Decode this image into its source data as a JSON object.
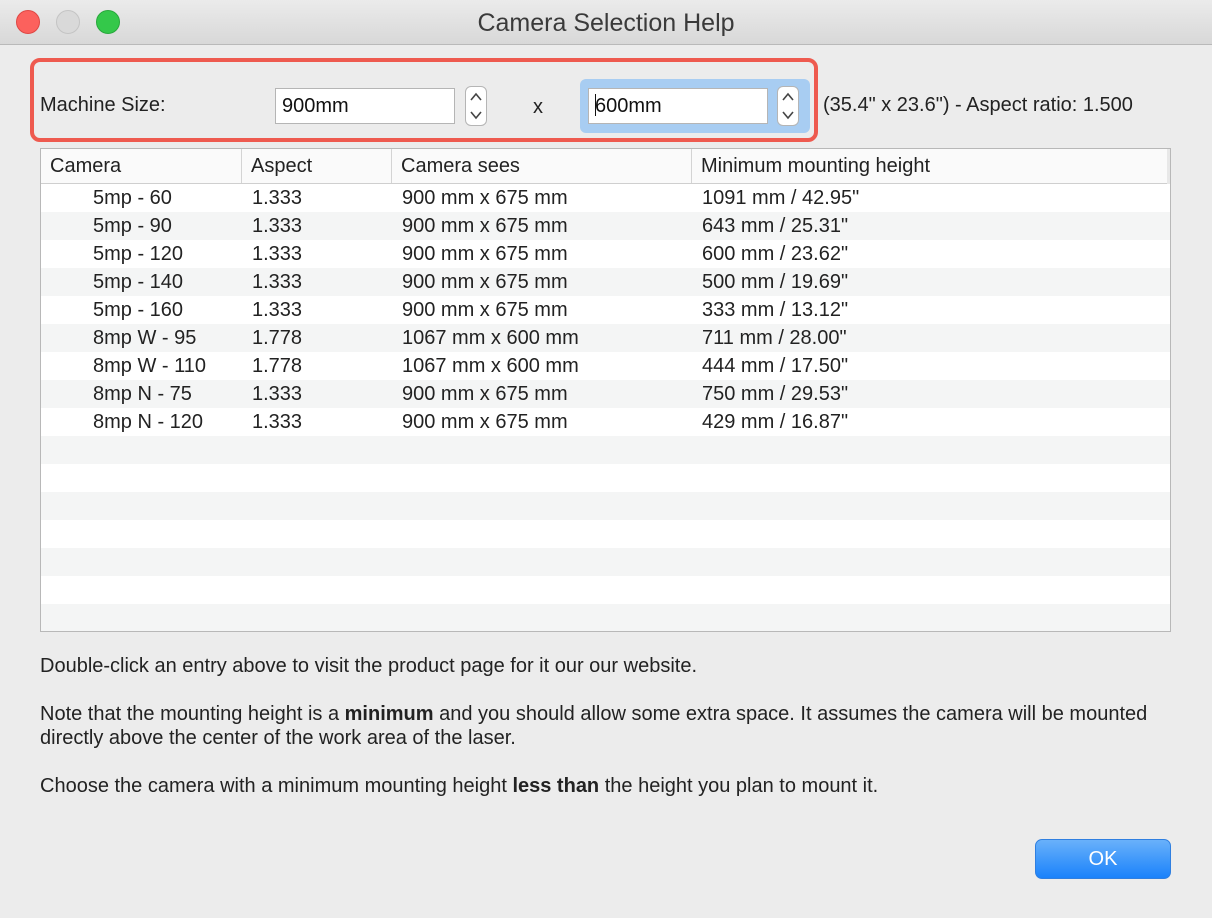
{
  "window": {
    "title": "Camera Selection Help"
  },
  "machine": {
    "label": "Machine Size:",
    "width_value": "900mm",
    "height_value": "600mm",
    "times": "x",
    "summary": "(35.4\" x 23.6\") - Aspect ratio: 1.500"
  },
  "table": {
    "columns": [
      "Camera",
      "Aspect",
      "Camera sees",
      "Minimum mounting height"
    ],
    "rows": [
      [
        "5mp - 60",
        "1.333",
        "900 mm x 675 mm",
        "1091 mm / 42.95\""
      ],
      [
        "5mp - 90",
        "1.333",
        "900 mm x 675 mm",
        "643 mm / 25.31\""
      ],
      [
        "5mp - 120",
        "1.333",
        "900 mm x 675 mm",
        "600 mm / 23.62\""
      ],
      [
        "5mp - 140",
        "1.333",
        "900 mm x 675 mm",
        "500 mm / 19.69\""
      ],
      [
        "5mp - 160",
        "1.333",
        "900 mm x 675 mm",
        "333 mm / 13.12\""
      ],
      [
        "8mp W - 95",
        "1.778",
        "1067 mm x 600 mm",
        "711 mm / 28.00\""
      ],
      [
        "8mp W - 110",
        "1.778",
        "1067 mm x 600 mm",
        "444 mm / 17.50\""
      ],
      [
        "8mp N - 75",
        "1.333",
        "900 mm x 675 mm",
        "750 mm / 29.53\""
      ],
      [
        "8mp N - 120",
        "1.333",
        "900 mm x 675 mm",
        "429 mm / 16.87\""
      ]
    ]
  },
  "help": {
    "p1": "Double-click an entry above to visit the product page for it our our website.",
    "p2_a": "Note that the mounting height is a ",
    "p2_b": "minimum",
    "p2_c": " and you should allow some extra space. It assumes the camera will be mounted directly above the center of the work area of the laser.",
    "p3_a": "Choose the camera with a minimum mounting height ",
    "p3_b": "less than",
    "p3_c": " the height you plan to mount it."
  },
  "buttons": {
    "ok": "OK"
  },
  "colors": {
    "highlight": "#ee5a4f",
    "focus": "#a8cdf2",
    "ok_button": "#1a82fb"
  }
}
